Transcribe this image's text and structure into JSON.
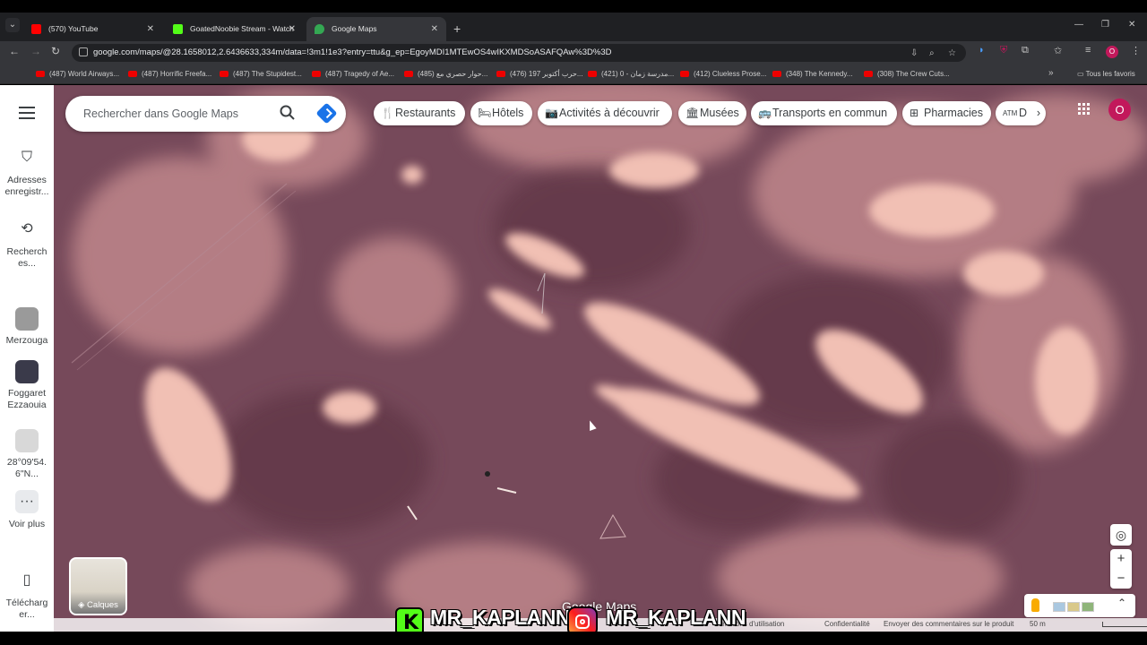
{
  "browser": {
    "tabs": [
      {
        "title": "(570) YouTube",
        "favicon_color": "#ff0000"
      },
      {
        "title": "GoatedNoobie Stream - Watch",
        "favicon_color": "#53fc18"
      },
      {
        "title": "Google Maps",
        "favicon_color": "#34a853"
      }
    ],
    "url": "google.com/maps/@28.1658012,2.6436633,334m/data=!3m1!1e3?entry=ttu&g_ep=EgoyMDI1MTEwOS4wIKXMDSoASAFQAw%3D%3D",
    "profile_initial": "O",
    "bookmarks": [
      "(487) World Airways...",
      "(487) Horrific Freefa...",
      "(487) The Stupidest...",
      "(487) Tragedy of Ae...",
      "(485) حوار حصري مع...",
      "(476) حرب أكتوبر 197...",
      "(421) مدرسة زمان - 0...",
      "(412) Clueless Prose...",
      "(348) The Kennedy...",
      "(308) The Crew Cuts..."
    ],
    "all_bookmarks": "Tous les favoris"
  },
  "sidebar": {
    "saved": "Adresses enregistr...",
    "recent": "Recherch es...",
    "places": [
      {
        "label": "Merzouga"
      },
      {
        "label": "Foggaret Ezzaouia"
      },
      {
        "label": "28°09'54. 6\"N..."
      }
    ],
    "more": "Voir plus",
    "download": "Télécharg er..."
  },
  "map": {
    "search_placeholder": "Rechercher dans Google Maps",
    "chips": [
      {
        "label": "Restaurants",
        "icon": "fork-knife-icon"
      },
      {
        "label": "Hôtels",
        "icon": "bed-icon"
      },
      {
        "label": "Activités à découvrir",
        "icon": "camera-icon"
      },
      {
        "label": "Musées",
        "icon": "museum-icon"
      },
      {
        "label": "Transports en commun",
        "icon": "bus-icon"
      },
      {
        "label": "Pharmacies",
        "icon": "pharmacy-icon"
      },
      {
        "label": "D",
        "icon": "atm-icon"
      }
    ],
    "avatar_initial": "O",
    "layers_label": "Calques",
    "logo": "Google Maps",
    "footer": {
      "terms": "Conditions d'utilisation",
      "privacy": "Confidentialité",
      "feedback": "Envoyer des commentaires sur le produit",
      "scale": "50 m"
    }
  },
  "watermark": {
    "kick_user": "MR_KAPLANN",
    "insta_user": "MR_KAPLANN"
  },
  "colors": {
    "terrain_dark": "#6e4552",
    "terrain_light": "#e9b0a8",
    "accent": "#1a73e8",
    "avatar": "#c2185b"
  }
}
